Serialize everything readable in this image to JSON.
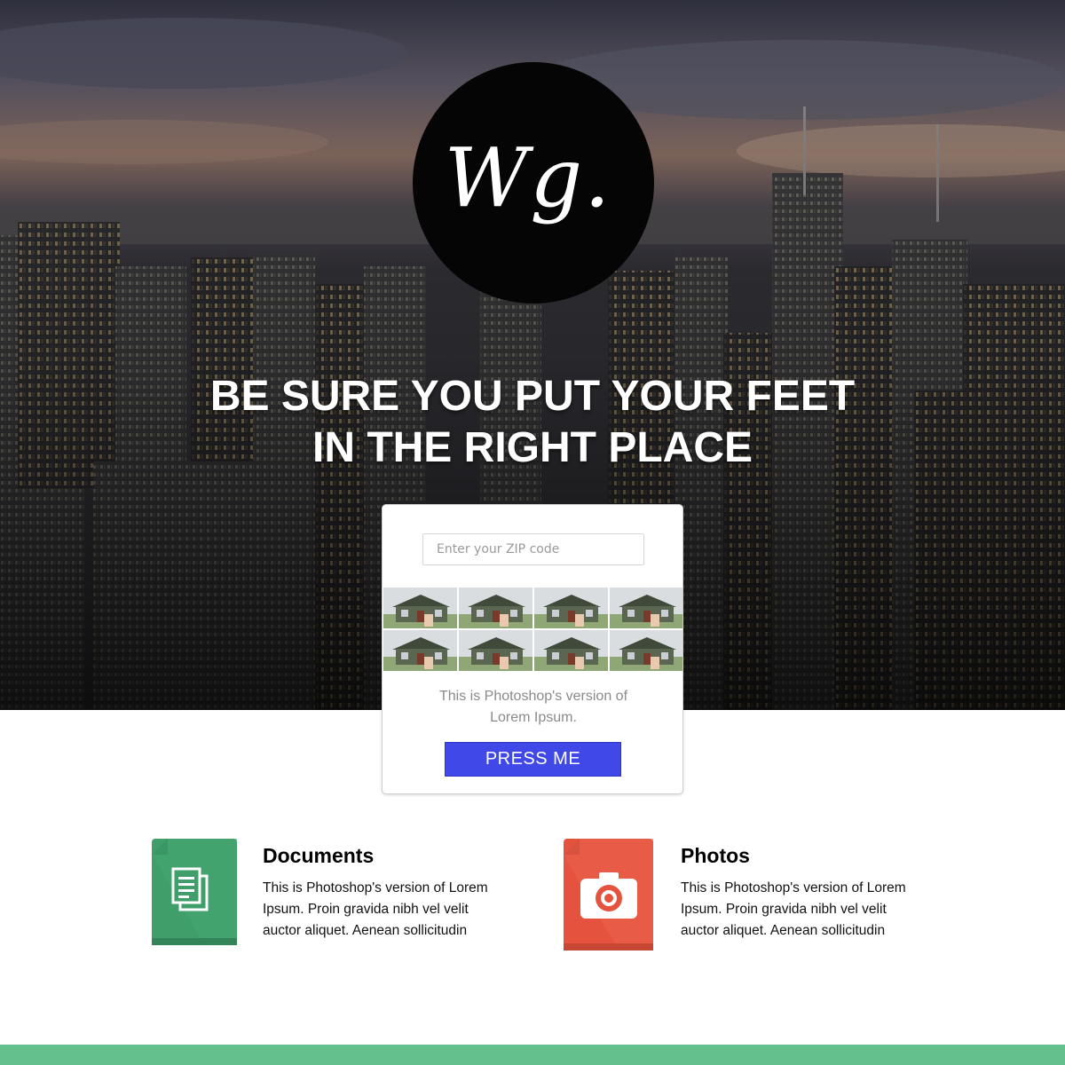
{
  "logo": {
    "text": "Wg."
  },
  "hero": {
    "headline_line1": "BE SURE YOU PUT YOUR FEET",
    "headline_line2": "IN THE RIGHT PLACE"
  },
  "card": {
    "zip_placeholder": "Enter your ZIP code",
    "zip_value": "",
    "thumbnails_count": 8,
    "text_line1": "This is Photoshop's version of",
    "text_line2": "Lorem Ipsum.",
    "button_label": "PRESS ME",
    "button_color": "#4048e8"
  },
  "features": [
    {
      "title": "Documents",
      "icon": "document-icon",
      "color": "#3f9e69",
      "desc_line1": "This is Photoshop's version of Lorem",
      "desc_line2": "Ipsum. Proin gravida nibh vel velit",
      "desc_line3": "auctor aliquet. Aenean sollicitudin"
    },
    {
      "title": "Photos",
      "icon": "camera-icon",
      "color": "#e5533f",
      "desc_line1": "This is Photoshop's version of Lorem",
      "desc_line2": "Ipsum. Proin gravida nibh vel velit",
      "desc_line3": "auctor aliquet. Aenean sollicitudin"
    }
  ],
  "footer": {
    "color": "#64c08c"
  }
}
